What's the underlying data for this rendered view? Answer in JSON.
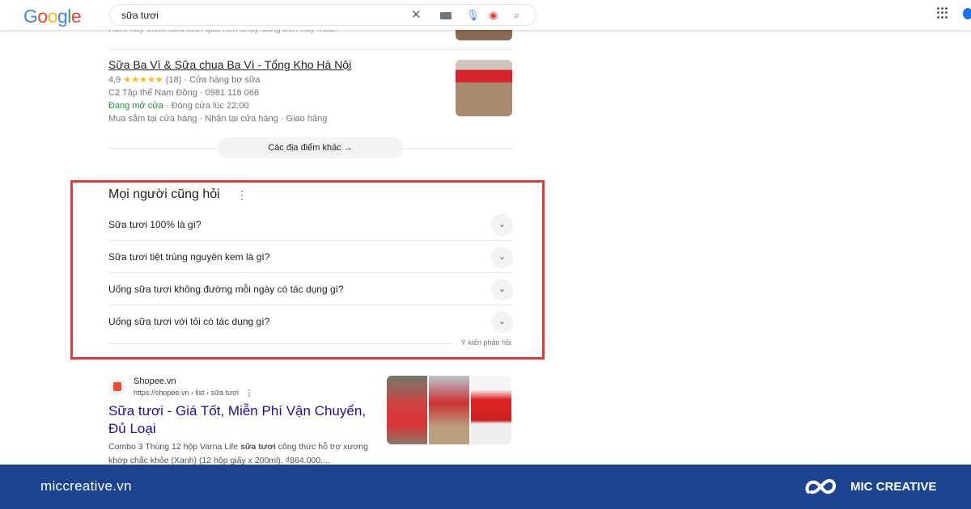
{
  "header": {
    "logo": "Google",
    "query": "sữa tươi"
  },
  "prev_snippet": "Hôm nay thêm sữa tươi quá nên chạy sang bên này mua.",
  "place": {
    "title": "Sữa Ba Vì & Sữa chua Ba Vì - Tổng Kho Hà Nội",
    "rating": "4,9",
    "stars": "★★★★★",
    "reviews": "(18)",
    "category": "· Cửa hàng bơ sữa",
    "address": "C2 Tập thể Nam Đồng · 0981 116 066",
    "open_status": "Đang mở cửa",
    "hours": "· Đóng cửa lúc 22:00",
    "services": "Mua sắm tại cửa hàng · Nhận tại cửa hàng · Giao hàng"
  },
  "more_places": "Các địa điểm khác",
  "paa": {
    "title": "Mọi người cũng hỏi",
    "questions": [
      "Sữa tươi 100% là gì?",
      "Sữa tươi tiệt trùng nguyên kem là gì?",
      "Uống sữa tươi không đường mỗi ngày có tác dụng gì?",
      "Uống sữa tươi với tỏi có tác dụng gì?"
    ],
    "feedback": "Ý kiến phản hồi",
    "highlight_color": "#e53935"
  },
  "result": {
    "site": "Shopee.vn",
    "url": "https://shopee.vn › list › sữa tươi",
    "title": "Sữa tươi - Giá Tốt, Miễn Phí Vận Chuyển, Đủ Loại",
    "desc_pre": "Combo 3 Thùng 12 hộp Varna Life ",
    "desc_bold": "sữa tươi",
    "desc_post": " công thức hỗ trợ xương khớp chắc khỏe (Xanh) (12 hộp giấy x 200ml). ₫864.000...."
  },
  "footer": {
    "site": "miccreative.vn",
    "brand": "MIC CREATIVE",
    "color": "#1d4491"
  }
}
